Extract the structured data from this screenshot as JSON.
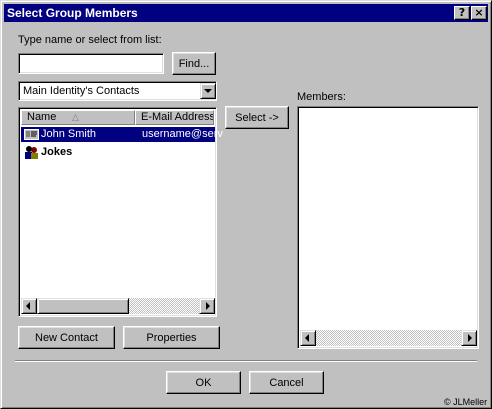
{
  "dialog": {
    "title": "Select Group Members",
    "help_label": "?",
    "close_label": "×"
  },
  "search": {
    "label": "Type name or select from list:",
    "value": "",
    "find_label": "Find..."
  },
  "address_book": {
    "selected": "Main Identity's Contacts"
  },
  "list": {
    "columns": [
      "Name",
      "E-Mail Address"
    ],
    "rows": [
      {
        "name": "John Smith",
        "email": "username@serv",
        "selected": true,
        "icon": "contact-card-icon"
      },
      {
        "name": "Jokes",
        "email": "",
        "selected": false,
        "icon": "group-people-icon"
      }
    ]
  },
  "select_button": "Select ->",
  "members": {
    "label": "Members:",
    "items": []
  },
  "buttons": {
    "new_contact": "New Contact",
    "properties": "Properties",
    "ok": "OK",
    "cancel": "Cancel"
  },
  "watermark": "© JLMeller",
  "colors": {
    "face": "#c0c0c0",
    "title_bar": "#000080",
    "selection": "#000080"
  }
}
